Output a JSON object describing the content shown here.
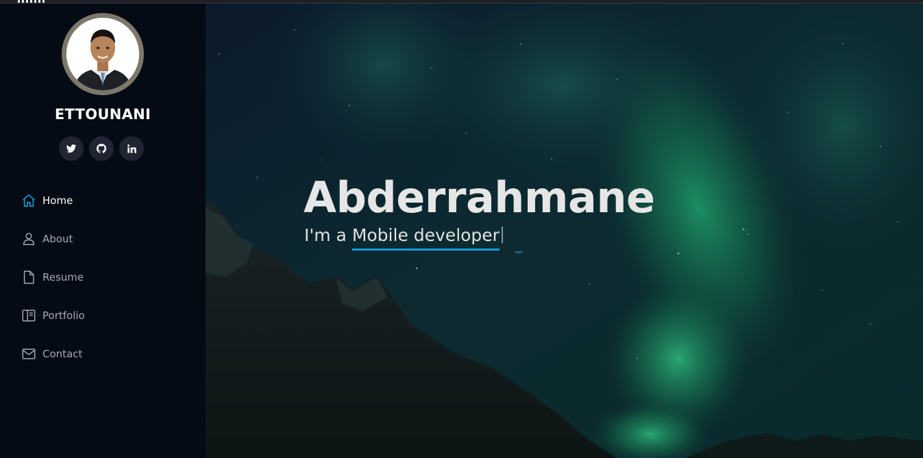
{
  "profile": {
    "name": "ETTOUNANI",
    "avatar_icon": "profile-photo"
  },
  "socials": [
    {
      "icon": "twitter-icon"
    },
    {
      "icon": "github-icon"
    },
    {
      "icon": "linkedin-icon"
    }
  ],
  "nav": {
    "items": [
      {
        "label": "Home",
        "icon": "home-icon",
        "active": true
      },
      {
        "label": "About",
        "icon": "person-icon",
        "active": false
      },
      {
        "label": "Resume",
        "icon": "file-icon",
        "active": false
      },
      {
        "label": "Portfolio",
        "icon": "book-half-icon",
        "active": false
      },
      {
        "label": "Contact",
        "icon": "envelope-icon",
        "active": false
      }
    ]
  },
  "hero": {
    "title": "Abderrahmane",
    "subtitle_prefix": "I'm a ",
    "typed_text": "Mobile developer"
  },
  "colors": {
    "accent": "#149ddd",
    "sidebar_bg": "#040b14",
    "nav_text": "#a8a9b4",
    "social_bg": "#212431"
  }
}
